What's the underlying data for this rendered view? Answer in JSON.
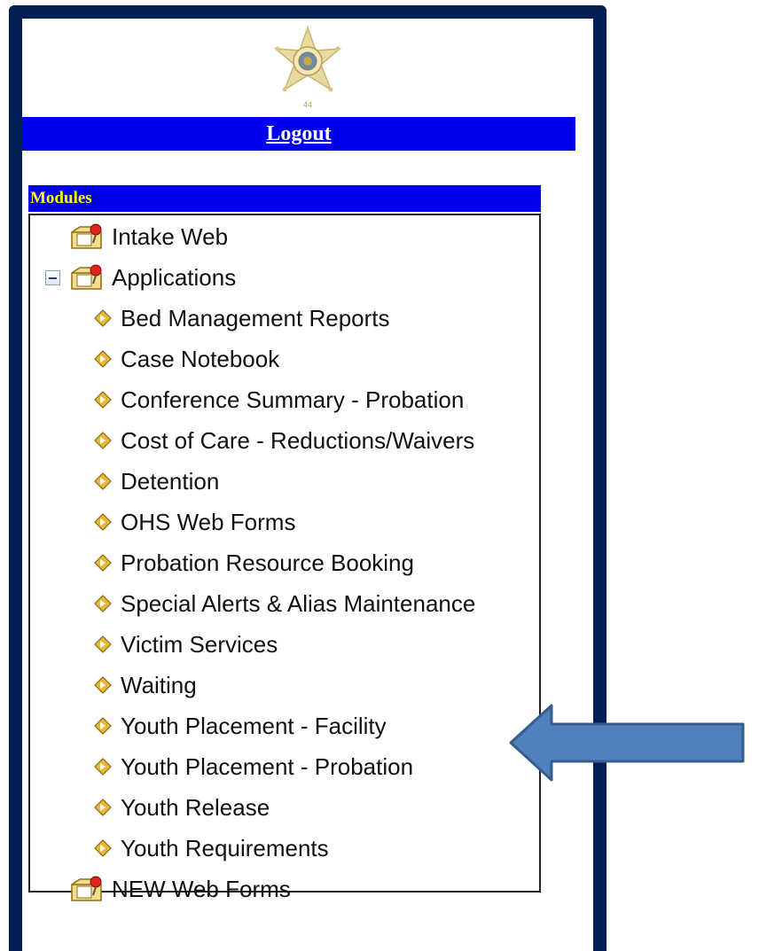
{
  "header": {
    "badge_icon": "sheriff-star-badge-icon",
    "logout_label": "Logout"
  },
  "modules": {
    "title": "Modules",
    "items": [
      {
        "label": "Intake Web",
        "icon": "module-folder-icon"
      },
      {
        "label": "Applications",
        "icon": "module-folder-icon",
        "expanded": true,
        "children": [
          "Bed Management Reports",
          "Case Notebook",
          "Conference Summary - Probation",
          "Cost of Care - Reductions/Waivers",
          "Detention",
          "OHS Web Forms",
          "Probation Resource Booking",
          "Special Alerts & Alias Maintenance",
          "Victim Services",
          "Waiting",
          "Youth Placement - Facility",
          "Youth Placement - Probation",
          "Youth Release",
          "Youth Requirements"
        ]
      },
      {
        "label": "NEW Web Forms",
        "icon": "module-folder-icon"
      }
    ]
  },
  "annotation": {
    "icon": "pointer-arrow-icon",
    "points_to": "Youth Placement - Probation"
  },
  "colors": {
    "frame": "#001f54",
    "header_bar": "#0000ee",
    "modules_title_text": "#ffff00",
    "arrow_fill": "#4f81bd",
    "arrow_stroke": "#385d8a"
  }
}
